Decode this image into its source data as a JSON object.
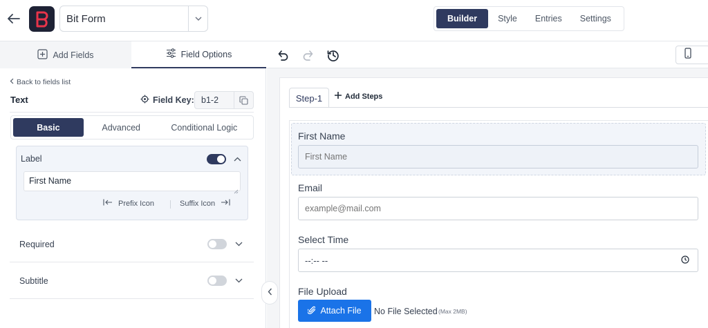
{
  "header": {
    "form_name": "Bit Form",
    "main_tabs": [
      "Builder",
      "Style",
      "Entries",
      "Settings"
    ]
  },
  "left_panel": {
    "tabs": {
      "add_fields": "Add Fields",
      "field_options": "Field Options"
    },
    "back_link": "Back to fields list",
    "field_type": "Text",
    "field_key_label": "Field Key:",
    "field_key_value": "b1-2",
    "sub_tabs": [
      "Basic",
      "Advanced",
      "Conditional Logic"
    ],
    "label_section": {
      "title": "Label",
      "value": "First Name",
      "prefix_icon": "Prefix Icon",
      "suffix_icon": "Suffix Icon"
    },
    "options": [
      {
        "label": "Required"
      },
      {
        "label": "Subtitle"
      }
    ]
  },
  "builder": {
    "step_tab": "Step-1",
    "add_steps": "Add Steps",
    "fields": {
      "first_name": {
        "label": "First Name",
        "placeholder": "First Name"
      },
      "email": {
        "label": "Email",
        "placeholder": "example@mail.com"
      },
      "select_time": {
        "label": "Select Time",
        "value": "--:-- --"
      },
      "file_upload": {
        "label": "File Upload",
        "button": "Attach File",
        "status": "No File Selected",
        "max_size": "(Max 2MB)"
      }
    }
  },
  "colors": {
    "accent_navy": "#2f3a5f",
    "attach_blue": "#1a73e8",
    "logo_red": "#e8344a"
  }
}
